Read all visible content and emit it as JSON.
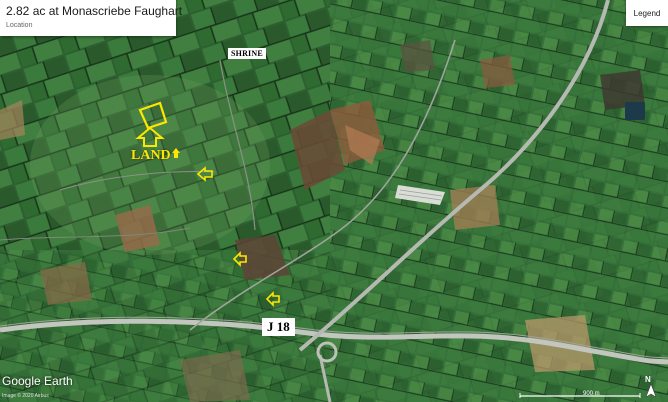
{
  "header": {
    "title": "2.82 ac at Monascriebe Faughart",
    "subtitle": "Location"
  },
  "legend_button": {
    "label": "Legend"
  },
  "map": {
    "labels": {
      "shrine": "SHRINE",
      "land": "LAND",
      "junction": "J 18"
    },
    "branding": "Google Earth",
    "imagery_credit": "Image © 2020 Airbus",
    "scale_label": "900 m",
    "north_label": "N",
    "colors": {
      "marker": "#ffe600",
      "field_green": "#2f6b34",
      "road": "#b5b9b2"
    }
  }
}
